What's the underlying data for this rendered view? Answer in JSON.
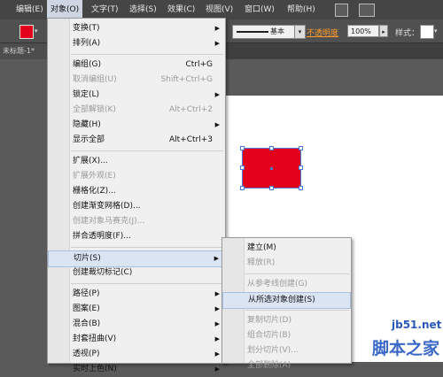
{
  "menubar": {
    "items": [
      "编辑(E)",
      "对象(O)",
      "文字(T)",
      "选择(S)",
      "效果(C)",
      "视图(V)",
      "窗口(W)",
      "帮助(H)"
    ],
    "active_index": 1
  },
  "options": {
    "stroke_style": "基本",
    "opacity_label": "不透明度",
    "opacity_value": "100%",
    "style_label": "样式："
  },
  "document": {
    "tab_title": "未标题-1*"
  },
  "object_menu": [
    {
      "label": "变换(T)",
      "arrow": "▶"
    },
    {
      "label": "排列(A)",
      "arrow": "▶"
    },
    {
      "sep": true
    },
    {
      "label": "编组(G)",
      "shortcut": "Ctrl+G"
    },
    {
      "label": "取消编组(U)",
      "shortcut": "Shift+Ctrl+G",
      "disabled": true
    },
    {
      "label": "锁定(L)",
      "arrow": "▶"
    },
    {
      "label": "全部解锁(K)",
      "shortcut": "Alt+Ctrl+2",
      "disabled": true
    },
    {
      "label": "隐藏(H)",
      "arrow": "▶"
    },
    {
      "label": "显示全部",
      "shortcut": "Alt+Ctrl+3"
    },
    {
      "sep": true
    },
    {
      "label": "扩展(X)..."
    },
    {
      "label": "扩展外观(E)",
      "disabled": true
    },
    {
      "label": "栅格化(Z)..."
    },
    {
      "label": "创建渐变网格(D)..."
    },
    {
      "label": "创建对象马赛克(J)...",
      "disabled": true
    },
    {
      "label": "拼合透明度(F)..."
    },
    {
      "sep": true
    },
    {
      "label": "切片(S)",
      "arrow": "▶",
      "highlight": true
    },
    {
      "label": "创建裁切标记(C)"
    },
    {
      "sep": true
    },
    {
      "label": "路径(P)",
      "arrow": "▶"
    },
    {
      "label": "图案(E)",
      "arrow": "▶"
    },
    {
      "label": "混合(B)",
      "arrow": "▶"
    },
    {
      "label": "封套扭曲(V)",
      "arrow": "▶"
    },
    {
      "label": "透视(P)",
      "arrow": "▶"
    },
    {
      "label": "实时上色(N)",
      "arrow": "▶"
    }
  ],
  "slice_menu": [
    {
      "label": "建立(M)"
    },
    {
      "label": "释放(R)",
      "disabled": true
    },
    {
      "sep": true
    },
    {
      "label": "从参考线创建(G)",
      "disabled": true
    },
    {
      "label": "从所选对象创建(S)",
      "highlight": true
    },
    {
      "sep": true
    },
    {
      "label": "复制切片(D)",
      "disabled": true
    },
    {
      "label": "组合切片(B)",
      "disabled": true
    },
    {
      "label": "划分切片(V)...",
      "disabled": true
    },
    {
      "label": "全部删除(A)",
      "disabled": true
    }
  ],
  "artwork": {
    "fill_color": "#e3001b"
  },
  "watermark": {
    "site": "jb51.net",
    "brand": "脚本之家"
  }
}
